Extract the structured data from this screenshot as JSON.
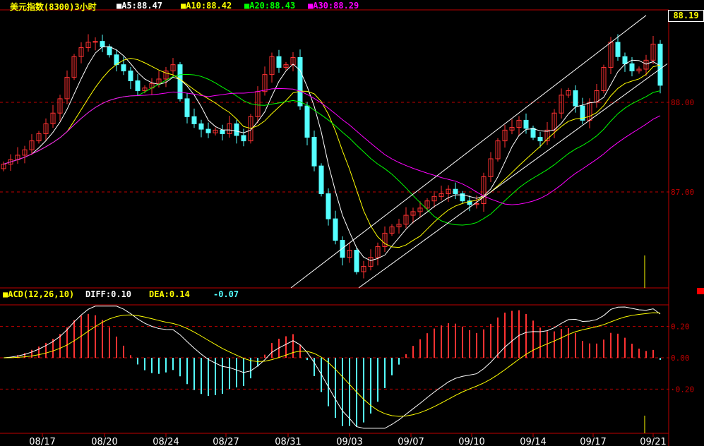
{
  "header": {
    "title": "美元指数(8300)3小时",
    "ma5": "■A5:88.47",
    "ma10": "■A10:88.42",
    "ma20": "■A20:88.43",
    "ma30": "■A30:88.29",
    "last_price": "88.19"
  },
  "macd_header": {
    "title": "■ACD(12,26,10)",
    "diff": "DIFF:0.10",
    "dea": "DEA:0.14",
    "macd": "-0.07"
  },
  "colors": {
    "up": "#ff3232",
    "down": "#54ffff",
    "ma5": "#ffffff",
    "ma10": "#ffff00",
    "ma20": "#00ff00",
    "ma30": "#ff00ff",
    "grid": "#c00000",
    "axis_text": "#c00000"
  },
  "chart_data": [
    {
      "type": "candlestick",
      "title": "美元指数(8300)3小时",
      "ylim": [
        85.93,
        88.97
      ],
      "yticks": [
        "88.00",
        "87.00"
      ],
      "ytick_values": [
        88.0,
        87.0
      ],
      "xticks": [
        {
          "label": "08/17",
          "index": 5.5
        },
        {
          "label": "08/20",
          "index": 14.3
        },
        {
          "label": "08/24",
          "index": 23
        },
        {
          "label": "08/27",
          "index": 31.5
        },
        {
          "label": "08/31",
          "index": 40.3
        },
        {
          "label": "09/03",
          "index": 49
        },
        {
          "label": "09/07",
          "index": 57.7
        },
        {
          "label": "09/10",
          "index": 66.3
        },
        {
          "label": "09/14",
          "index": 75
        },
        {
          "label": "09/17",
          "index": 83.5
        },
        {
          "label": "09/21",
          "index": 92
        }
      ],
      "close": [
        87.31,
        87.36,
        87.41,
        87.47,
        87.57,
        87.65,
        87.76,
        87.88,
        88.04,
        88.28,
        88.51,
        88.61,
        88.67,
        88.68,
        88.62,
        88.53,
        88.42,
        88.35,
        88.24,
        88.13,
        88.16,
        88.21,
        88.26,
        88.35,
        88.42,
        88.04,
        87.84,
        87.76,
        87.7,
        87.66,
        87.69,
        87.65,
        87.76,
        87.63,
        87.57,
        87.84,
        88.12,
        88.31,
        88.51,
        88.39,
        88.42,
        88.5,
        87.96,
        87.61,
        87.29,
        86.98,
        86.7,
        86.46,
        86.27,
        86.35,
        86.11,
        86.17,
        86.27,
        86.39,
        86.54,
        86.61,
        86.64,
        86.74,
        86.78,
        86.82,
        86.9,
        86.95,
        86.98,
        87.03,
        86.98,
        86.9,
        86.86,
        86.87,
        87.17,
        87.37,
        87.57,
        87.69,
        87.72,
        87.8,
        87.71,
        87.61,
        87.57,
        87.69,
        87.88,
        88.08,
        88.13,
        87.96,
        87.8,
        88.0,
        88.13,
        88.39,
        88.67,
        88.51,
        88.43,
        88.35,
        88.37,
        88.47,
        88.65,
        88.19
      ],
      "moving_averages": [
        5,
        10,
        20,
        30
      ],
      "trendlines": [
        {
          "from": [
            40.7,
            85.93
          ],
          "to": [
            91.0,
            88.97
          ]
        },
        {
          "from": [
            50.3,
            85.93
          ],
          "to": [
            94.0,
            88.43
          ]
        }
      ]
    },
    {
      "type": "macd",
      "params": [
        12,
        26,
        10
      ],
      "ylim": [
        -0.45,
        0.33
      ],
      "yticks": [
        "0.20",
        "0.00",
        "-0.20"
      ],
      "ytick_values": [
        0.2,
        0.0,
        -0.2
      ]
    }
  ]
}
